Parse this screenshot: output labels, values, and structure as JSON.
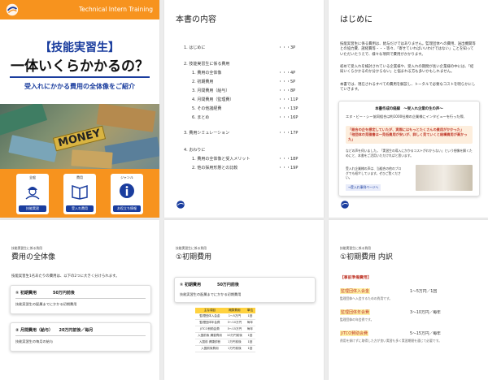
{
  "cover": {
    "header": "Technical Intern Training",
    "title1": "【技能実習生】",
    "title2": "一体いくらかかるの？",
    "subtitle": "受入れにかかる費用の全体像をご紹介",
    "money_text": "MONEY",
    "icons": [
      {
        "label": "全般",
        "icon": "worker-icon",
        "button": "技能実習"
      },
      {
        "label": "費用",
        "icon": "book-icon",
        "button": "受入れ費用"
      },
      {
        "label": "ジャンル",
        "icon": "info-icon",
        "button": "お役立ち情報"
      }
    ]
  },
  "toc": {
    "title": "本書の内容",
    "items": [
      {
        "text": "1.  はじめに",
        "page": "・・・3P"
      },
      {
        "text": "2.  技能実習生に係る費用",
        "page": ""
      },
      {
        "text": "1.  費用の全体像",
        "page": "・・・4P"
      },
      {
        "text": "2.  初期費用",
        "page": "・・・5P"
      },
      {
        "text": "3.  月間費用（給与）",
        "page": "・・・8P"
      },
      {
        "text": "4.  月間費用（監理費）",
        "page": "・・・11P"
      },
      {
        "text": "5.  その他諸経費",
        "page": "・・・13P"
      },
      {
        "text": "6.  まとめ",
        "page": "・・・16P"
      },
      {
        "text": "3.  費用シミュレーション",
        "page": "・・・17P"
      },
      {
        "text": "4.  おわりに",
        "page": ""
      },
      {
        "text": "1.  費用の全体像と受入メリット",
        "page": "・・・18P"
      },
      {
        "text": "2.  他の採用形態との比較",
        "page": "・・・19P"
      }
    ]
  },
  "intro": {
    "title": "はじめに",
    "para1": "技能実習生に係る費用は、給与だけではありません。監理団体への費用、送出機関等との協力費、諸経費等・・・等々、「寄せていればいいわけではない」ことを知っていただいたうえで、様々な項目で費用がかかります。",
    "para2": "初めて受入れを検討されている企業様や、受入れの期間が長い企業様の中には、「結局いくらかかるのか分からない」と悩まれる方も多いかもしれません。",
    "para3": "本書では、現在されるすべての費用を解説し、トータルで必要なコストを明らかにしていきます。",
    "box_title": "本書作成の経緯　～受入れ企業の生の声～",
    "box_line": "エヌ・ビー・シー協同組合は約1000社様の企業様にインタビューを行った際、",
    "box_q1": "「総合の企を想定していたが、実際にはもっとたくさんの費用がかかった」",
    "box_q2": "「他団体の見積書は一見低費用が安いが、詳しく見ていくと結構費用が高かった」",
    "box_small1": "などの声を伺いました。「実習生の導入にかかるコストがわからない」という想像を解くためにと、本書をご活用いただければと思います。",
    "box_small2": "受入れ企業様の声は、当組合の他のブログでも紹介しています。ぜひご覧ください。",
    "box_link": "→受入れ事例ページへ"
  },
  "overview": {
    "header": "技能実習生に係る費用",
    "title": "費用の全体像",
    "text": "技能実習生1名あたりの費用は、以下の2つに大きく分けられます。",
    "card1_title": "① 初期費用　　　　50万円前後",
    "card1_desc": "技能実習生の配属までにかかる初期費用",
    "card2_title": "② 月間費用（給与）　　20万円前後／毎月",
    "card2_desc": "技能実習生の毎月の給与"
  },
  "initial": {
    "header": "技能実習生に係る費用",
    "title": "①初期費用",
    "card_title": "① 初期費用　　　　50万円前後",
    "card_desc": "技能実習生の配属までにかかる初期費用",
    "table_headers": [
      "主な項目",
      "概算費用",
      "単位"
    ],
    "table_rows": [
      [
        "監理団体入会金",
        "1〜5万円",
        "1回"
      ],
      [
        "監理団体年会費",
        "3〜10万円",
        "毎年"
      ],
      [
        "JITCO賛助会費",
        "5〜15万円",
        "毎年"
      ],
      [
        "入国前後 講習費用",
        "10万円前後",
        "1回"
      ],
      [
        "入国前 健康診断",
        "1万円前後",
        "1回"
      ],
      [
        "入国前後費用",
        "1万円前後",
        "1回"
      ]
    ]
  },
  "breakdown": {
    "header": "技能実習生に係る費用",
    "title": "①初期費用 内訳",
    "section": "【事前準備費用】",
    "items": [
      {
        "name": "監理団体入会金",
        "amount": "1〜5万円／1回",
        "desc": "監理団体へ入会するための費用です。"
      },
      {
        "name": "監理団体年会費",
        "amount": "3〜10万円／毎年",
        "desc": "監理団体の年会費です。"
      },
      {
        "name": "JITCO賛助会費",
        "amount": "5〜15万円／毎年",
        "desc": "費用を掛けずに取得した方が良い実習も多く実習期間を通じて必要です。"
      }
    ]
  },
  "colors": {
    "orange": "#f7931e",
    "navy": "#1a3d9e",
    "red": "#c0392b",
    "yellow": "#ffd23f"
  }
}
